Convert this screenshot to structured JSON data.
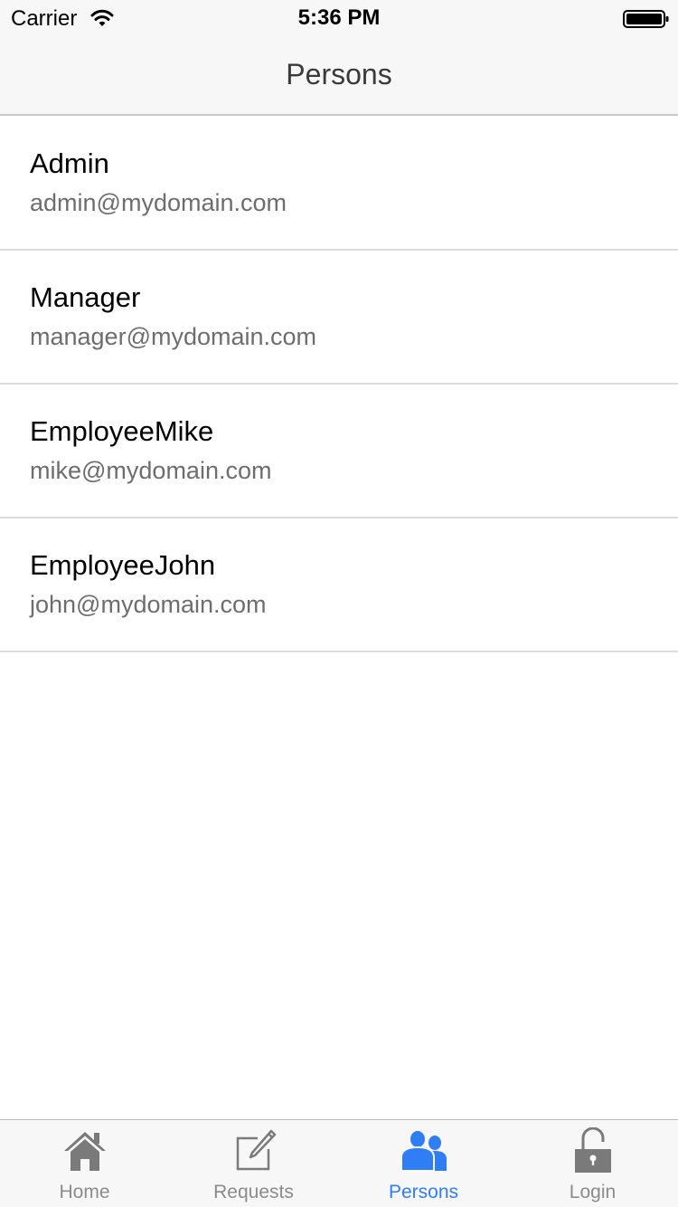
{
  "status_bar": {
    "carrier": "Carrier",
    "time": "5:36 PM"
  },
  "nav": {
    "title": "Persons"
  },
  "persons": [
    {
      "name": "Admin",
      "email": "admin@mydomain.com"
    },
    {
      "name": "Manager",
      "email": "manager@mydomain.com"
    },
    {
      "name": "EmployeeMike",
      "email": "mike@mydomain.com"
    },
    {
      "name": "EmployeeJohn",
      "email": "john@mydomain.com"
    }
  ],
  "tabs": [
    {
      "label": "Home",
      "icon": "home-icon",
      "active": false
    },
    {
      "label": "Requests",
      "icon": "edit-icon",
      "active": false
    },
    {
      "label": "Persons",
      "icon": "persons-icon",
      "active": true
    },
    {
      "label": "Login",
      "icon": "unlocked-padlock-icon",
      "active": false
    }
  ],
  "colors": {
    "accent": "#2f7ef6",
    "inactive_icon": "#7a7a7a",
    "bar_background": "#f7f7f7"
  }
}
